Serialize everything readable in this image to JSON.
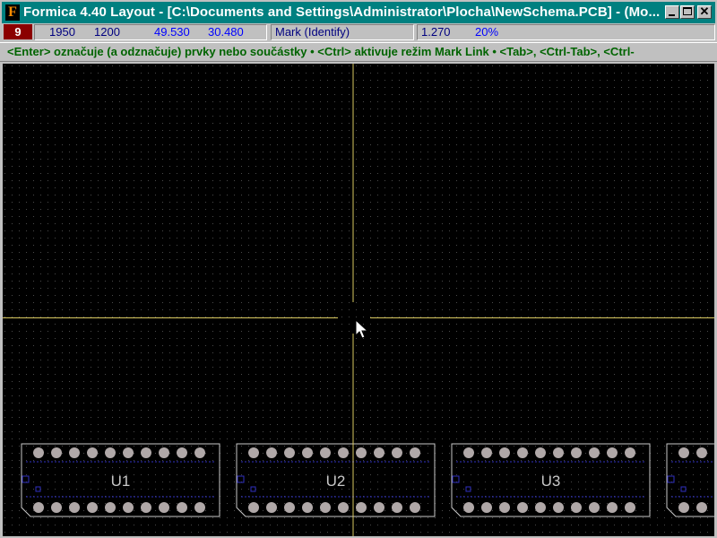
{
  "window": {
    "title": "Formica 4.40 Layout - [C:\\Documents and Settings\\Administrator\\Plocha\\NewSchema.PCB] - (Mo...",
    "app_icon_letter": "F",
    "controls": [
      "minimize-icon",
      "maximize-icon",
      "close-icon"
    ]
  },
  "statusbar": {
    "layer": "9",
    "x_mils": "1950",
    "y_mils": "1200",
    "x_mm": "49.530",
    "y_mm": "30.480",
    "mode": "Mark (Identify)",
    "grid": "1.270",
    "zoom": "20%"
  },
  "hint": "<Enter> označuje (a odznačuje) prvky nebo součástky  •  <Ctrl> aktivuje režim Mark Link  •  <Tab>, <Ctrl-Tab>, <Ctrl-",
  "colors": {
    "background": "#000000",
    "grid_dot": "#4a4a4a",
    "crosshair": "#d8c860",
    "outline": "#c8c8c8",
    "pad": "#b0a8a8",
    "trace": "#3030c0",
    "layer_badge": "#8b0000",
    "title_bar": "#008080",
    "hint_text": "#006400"
  },
  "components": [
    {
      "ref": "U1"
    },
    {
      "ref": "U2"
    },
    {
      "ref": "U3"
    },
    {
      "ref": ""
    }
  ]
}
